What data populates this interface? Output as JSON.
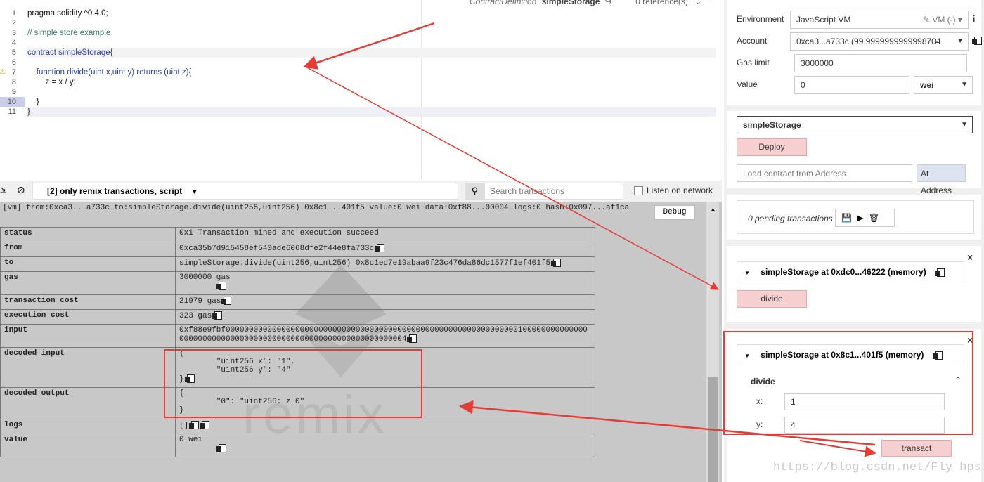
{
  "editor": {
    "topbar": {
      "definition_label": "ContractDefinition",
      "contract_name": "simpleStorage",
      "references": "0 reference(s)"
    },
    "line_numbers": [
      "1",
      "2",
      "3",
      "4",
      "5",
      "6",
      "7",
      "8",
      "9",
      "10",
      "11"
    ],
    "lines": [
      "pragma solidity ^0.4.0;",
      "",
      "// simple store example",
      "",
      "contract simpleStorage{",
      "",
      "    function divide(uint x,uint y) returns (uint z){",
      "        z = x / y;",
      "",
      "    }",
      "}"
    ]
  },
  "terminal": {
    "filter": "[2] only remix transactions, script",
    "search_placeholder": "Search transactions",
    "listen_label": "Listen on network",
    "tx_summary": "[vm] from:0xca3...a733c to:simpleStorage.divide(uint256,uint256) 0x8c1...401f5 value:0 wei data:0xf88...00004 logs:0 hash:0x097...af1ca",
    "debug_label": "Debug",
    "watermark": "remix",
    "rows": [
      {
        "key": "status",
        "value": "0x1 Transaction mined and execution succeed"
      },
      {
        "key": "from",
        "value": "0xca35b7d915458ef540ade6068dfe2f44e8fa733c"
      },
      {
        "key": "to",
        "value": "simpleStorage.divide(uint256,uint256) 0x8c1ed7e19abaa9f23c476da86dc1577f1ef401f5"
      },
      {
        "key": "gas",
        "value": "3000000 gas"
      },
      {
        "key": "transaction cost",
        "value": "21979 gas"
      },
      {
        "key": "execution cost",
        "value": "323 gas"
      },
      {
        "key": "input",
        "value": "0xf88e9fbf0000000000000000000000000000000000000000000000000000000000000001000000000000000000000000000000000000000000000000000000000000004"
      },
      {
        "key": "decoded input",
        "value": "{\n        \"uint256 x\": \"1\",\n        \"uint256 y\": \"4\"\n}"
      },
      {
        "key": "decoded output",
        "value": "{\n        \"0\": \"uint256: z 0\"\n}"
      },
      {
        "key": "logs",
        "value": "[]"
      },
      {
        "key": "value",
        "value": "0 wei"
      }
    ]
  },
  "run": {
    "environment_label": "Environment",
    "environment_value": "JavaScript VM",
    "vm_badge": "VM (-)",
    "account_label": "Account",
    "account_value": "0xca3...a733c (99.9999999999998704",
    "gas_limit_label": "Gas limit",
    "gas_limit_value": "3000000",
    "value_label": "Value",
    "value_value": "0",
    "value_unit": "wei",
    "contract_select": "simpleStorage",
    "deploy_label": "Deploy",
    "load_placeholder": "Load contract from Address",
    "at_address_label": "At Address",
    "pending": "0 pending transactions",
    "instance1_title": "simpleStorage at 0xdc0...46222 (memory)",
    "instance1_fn": "divide",
    "instance2_title": "simpleStorage at 0x8c1...401f5 (memory)",
    "instance2_fn": "divide",
    "x_label": "x:",
    "x_value": "1",
    "y_label": "y:",
    "y_value": "4",
    "transact_label": "transact",
    "watermark_url": "https://blog.csdn.net/Fly_hps"
  },
  "colors": {
    "highlight_red": "#e53c36",
    "button_pink": "#f6cfd0"
  }
}
